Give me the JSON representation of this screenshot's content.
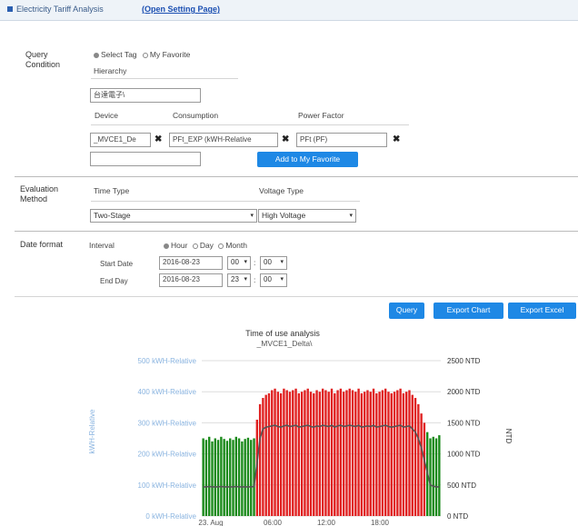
{
  "header": {
    "title": "Electricity Tariff Analysis",
    "setting_link": "(Open Setting Page)"
  },
  "query_condition": {
    "label": "Query Condition",
    "radio_select_tag": "Select Tag",
    "radio_my_favorite": "My Favorite",
    "hierarchy_label": "Hierarchy",
    "hierarchy_value": "台達電子\\",
    "device_label": "Device",
    "consumption_label": "Consumption",
    "power_factor_label": "Power Factor",
    "device_value": "_MVCE1_De",
    "consumption_value": "PFt_EXP (kWH-Relative",
    "power_factor_value": "PFt (PF)",
    "favorite_name_value": "",
    "add_favorite_label": "Add to My Favorite"
  },
  "evaluation": {
    "label": "Evaluation Method",
    "time_type_label": "Time Type",
    "voltage_type_label": "Voltage Type",
    "time_type_value": "Two-Stage",
    "voltage_type_value": "High Voltage"
  },
  "date_format": {
    "label": "Date format",
    "interval_label": "Interval",
    "opt_hour": "Hour",
    "opt_day": "Day",
    "opt_month": "Month",
    "start_label": "Start Date",
    "end_label": "End Day",
    "start_date": "2016-08-23",
    "start_hour": "00",
    "start_min": "00",
    "end_date": "2016-08-23",
    "end_hour": "23",
    "end_min": "00"
  },
  "actions": {
    "query": "Query",
    "export_chart": "Export Chart",
    "export_excel": "Export Excel"
  },
  "colors": {
    "accent": "#1e88e5",
    "bar_offpeak": "#1a8a1a",
    "bar_peak": "#e02020",
    "line": "#555555"
  },
  "chart_data": {
    "type": "bar",
    "title": "Time of use analysis",
    "subtitle": "_MVCE1_Delta\\",
    "ylabel_left": "kWH-Relative",
    "ylabel_right": "NTD",
    "ylim_left": [
      0,
      500
    ],
    "ylim_right": [
      0,
      2500
    ],
    "left_ticks": [
      "0 kWH-Relative",
      "100 kWH-Relative",
      "200 kWH-Relative",
      "300 kWH-Relative",
      "400 kWH-Relative",
      "500 kWH-Relative"
    ],
    "right_ticks": [
      "0 NTD",
      "500 NTD",
      "1000 NTD",
      "1500 NTD",
      "2000 NTD",
      "2500 NTD"
    ],
    "x_ticks": [
      "23. Aug",
      "06:00",
      "12:00",
      "18:00"
    ],
    "series": [
      {
        "kind": "bars",
        "values": [
          250,
          245,
          255,
          240,
          250,
          245,
          255,
          248,
          242,
          250,
          245,
          255,
          250,
          240,
          248,
          252,
          245,
          250,
          310,
          360,
          380,
          390,
          395,
          405,
          410,
          400,
          395,
          410,
          405,
          400,
          405,
          410,
          395,
          400,
          405,
          410,
          400,
          395,
          405,
          400,
          410,
          405,
          400,
          410,
          395,
          405,
          410,
          400,
          405,
          410,
          405,
          400,
          410,
          395,
          400,
          405,
          400,
          410,
          395,
          400,
          405,
          410,
          400,
          395,
          400,
          405,
          410,
          395,
          400,
          405,
          390,
          380,
          360,
          330,
          300,
          270,
          250,
          255,
          250,
          260
        ],
        "period": [
          "off",
          "off",
          "off",
          "off",
          "off",
          "off",
          "off",
          "off",
          "off",
          "off",
          "off",
          "off",
          "off",
          "off",
          "off",
          "off",
          "off",
          "off",
          "peak",
          "peak",
          "peak",
          "peak",
          "peak",
          "peak",
          "peak",
          "peak",
          "peak",
          "peak",
          "peak",
          "peak",
          "peak",
          "peak",
          "peak",
          "peak",
          "peak",
          "peak",
          "peak",
          "peak",
          "peak",
          "peak",
          "peak",
          "peak",
          "peak",
          "peak",
          "peak",
          "peak",
          "peak",
          "peak",
          "peak",
          "peak",
          "peak",
          "peak",
          "peak",
          "peak",
          "peak",
          "peak",
          "peak",
          "peak",
          "peak",
          "peak",
          "peak",
          "peak",
          "peak",
          "peak",
          "peak",
          "peak",
          "peak",
          "peak",
          "peak",
          "peak",
          "peak",
          "peak",
          "peak",
          "peak",
          "peak",
          "off",
          "off",
          "off",
          "off",
          "off"
        ]
      },
      {
        "kind": "line",
        "values": [
          470,
          470,
          475,
          470,
          470,
          470,
          475,
          470,
          470,
          470,
          470,
          475,
          470,
          470,
          470,
          470,
          470,
          475,
          850,
          1250,
          1400,
          1430,
          1440,
          1450,
          1460,
          1440,
          1430,
          1450,
          1460,
          1440,
          1450,
          1460,
          1430,
          1440,
          1450,
          1460,
          1440,
          1430,
          1450,
          1440,
          1460,
          1450,
          1440,
          1460,
          1430,
          1450,
          1460,
          1440,
          1450,
          1460,
          1450,
          1440,
          1460,
          1430,
          1440,
          1450,
          1440,
          1460,
          1430,
          1440,
          1450,
          1460,
          1440,
          1430,
          1440,
          1450,
          1460,
          1430,
          1440,
          1450,
          1400,
          1350,
          1250,
          1100,
          900,
          700,
          500,
          480,
          470,
          470
        ]
      }
    ]
  }
}
